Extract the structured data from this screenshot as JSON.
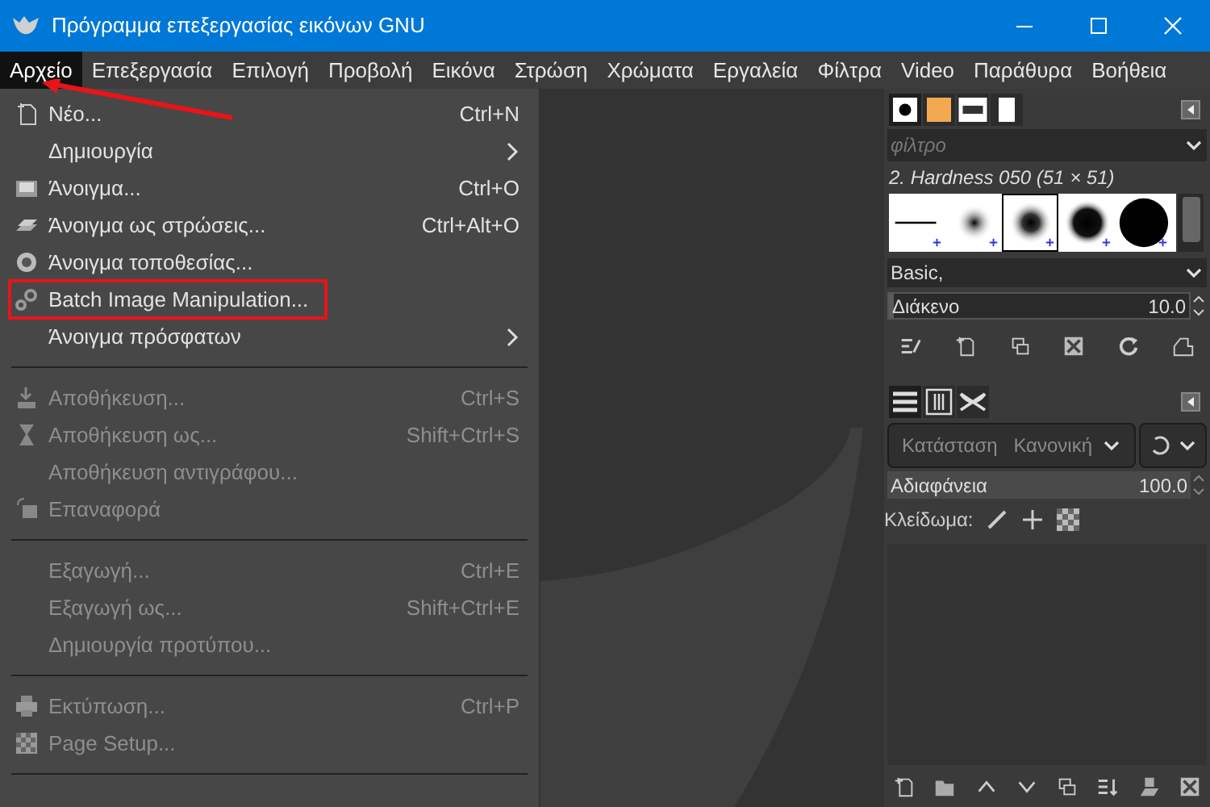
{
  "window": {
    "title": "Πρόγραμμα επεξεργασίας εικόνων GNU"
  },
  "menubar": [
    {
      "label": "Αρχείο",
      "selected": true
    },
    {
      "label": "Επεξεργασία",
      "selected": false
    },
    {
      "label": "Επιλογή",
      "selected": false
    },
    {
      "label": "Προβολή",
      "selected": false
    },
    {
      "label": "Εικόνα",
      "selected": false
    },
    {
      "label": "Στρώση",
      "selected": false
    },
    {
      "label": "Χρώματα",
      "selected": false
    },
    {
      "label": "Εργαλεία",
      "selected": false
    },
    {
      "label": "Φίλτρα",
      "selected": false
    },
    {
      "label": "Video",
      "selected": false
    },
    {
      "label": "Παράθυρα",
      "selected": false
    },
    {
      "label": "Βοήθεια",
      "selected": false
    }
  ],
  "file_menu": [
    {
      "kind": "item",
      "label": "Νέο...",
      "shortcut": "Ctrl+N",
      "disabled": false,
      "submenu": false,
      "annotated": false
    },
    {
      "kind": "item",
      "label": "Δημιουργία",
      "disabled": false,
      "submenu": true,
      "annotated": false
    },
    {
      "kind": "item",
      "label": "Άνοιγμα...",
      "shortcut": "Ctrl+O",
      "disabled": false,
      "submenu": false,
      "annotated": false
    },
    {
      "kind": "item",
      "label": "Άνοιγμα ως στρώσεις...",
      "shortcut": "Ctrl+Alt+O",
      "disabled": false,
      "submenu": false,
      "annotated": false
    },
    {
      "kind": "item",
      "label": "Άνοιγμα τοποθεσίας...",
      "disabled": false,
      "submenu": false,
      "annotated": false
    },
    {
      "kind": "item",
      "label": "Batch Image Manipulation...",
      "disabled": false,
      "submenu": false,
      "annotated": true
    },
    {
      "kind": "item",
      "label": "Άνοιγμα πρόσφατων",
      "disabled": false,
      "submenu": true,
      "annotated": false
    },
    {
      "kind": "separator"
    },
    {
      "kind": "item",
      "label": "Αποθήκευση...",
      "shortcut": "Ctrl+S",
      "disabled": true,
      "submenu": false,
      "annotated": false
    },
    {
      "kind": "item",
      "label": "Αποθήκευση ως...",
      "shortcut": "Shift+Ctrl+S",
      "disabled": true,
      "submenu": false,
      "annotated": false
    },
    {
      "kind": "item",
      "label": "Αποθήκευση αντιγράφου...",
      "disabled": true,
      "submenu": false,
      "annotated": false
    },
    {
      "kind": "item",
      "label": "Επαναφορά",
      "disabled": true,
      "submenu": false,
      "annotated": false
    },
    {
      "kind": "separator"
    },
    {
      "kind": "item",
      "label": "Εξαγωγή...",
      "shortcut": "Ctrl+E",
      "disabled": true,
      "submenu": false,
      "annotated": false
    },
    {
      "kind": "item",
      "label": "Εξαγωγή ως...",
      "shortcut": "Shift+Ctrl+E",
      "disabled": true,
      "submenu": false,
      "annotated": false
    },
    {
      "kind": "item",
      "label": "Δημιουργία προτύπου...",
      "disabled": true,
      "submenu": false,
      "annotated": false
    },
    {
      "kind": "separator"
    },
    {
      "kind": "item",
      "label": "Εκτύπωση...",
      "shortcut": "Ctrl+P",
      "disabled": true,
      "submenu": false,
      "annotated": false
    },
    {
      "kind": "item",
      "label": "Page Setup...",
      "disabled": true,
      "submenu": false,
      "annotated": false
    },
    {
      "kind": "separator"
    }
  ],
  "brushes_panel": {
    "tabs": [
      {
        "selected": true
      },
      {
        "selected": false
      },
      {
        "selected": false
      },
      {
        "selected": false
      }
    ],
    "filter": {
      "placeholder": "φίλτρο"
    },
    "brush_name": "2. Hardness 050 (51 × 51)",
    "brushes": [
      {
        "selected": false
      },
      {
        "selected": false
      },
      {
        "selected": true
      },
      {
        "selected": false
      },
      {
        "selected": false
      }
    ],
    "tag": "Basic,",
    "spacing": {
      "label": "Διάκενο",
      "value": "10.0",
      "level": 0.01
    }
  },
  "layers_panel": {
    "tabs": [
      {
        "selected": true
      },
      {
        "selected": false
      },
      {
        "selected": false
      }
    ],
    "mode": {
      "label": "Κατάσταση",
      "value": "Κανονική"
    },
    "opacity": {
      "label": "Αδιαφάνεια",
      "value": "100.0",
      "level": 1.0
    },
    "lock": {
      "label": "Κλείδωμα:"
    }
  }
}
